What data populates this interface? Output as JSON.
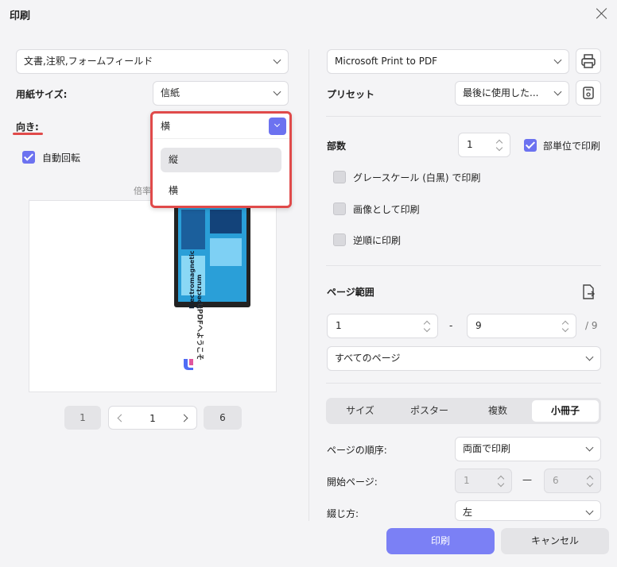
{
  "dialog": {
    "title": "印刷"
  },
  "left": {
    "content_select": "文書,注釈,フォームフィールド",
    "paper_size_label": "用紙サイズ:",
    "paper_size_value": "信紙",
    "orientation_label": "向き:",
    "orientation_value": "横",
    "auto_rotate_label": "自動回転",
    "scale_label_partial": "倍率",
    "orientation_options": [
      "縦",
      "横"
    ],
    "pager": {
      "first": "1",
      "current": "1",
      "last": "6"
    },
    "preview_text": {
      "banner1": "Electromagnetic",
      "banner2": "Spectrum",
      "welcome": "UPDFへようこそ"
    }
  },
  "right": {
    "printer": "Microsoft Print to PDF",
    "preset_label": "プリセット",
    "preset_value": "最後に使用した...",
    "copies_label": "部数",
    "copies_value": "1",
    "collate_label": "部単位で印刷",
    "grayscale_label": "グレースケール (白黒) で印刷",
    "as_image_label": "画像として印刷",
    "reverse_label": "逆順に印刷",
    "page_range_label": "ページ範囲",
    "range_from": "1",
    "range_sep": "-",
    "range_to": "9",
    "range_total": "/ 9",
    "range_subset": "すべてのページ",
    "tabs": [
      "サイズ",
      "ポスター",
      "複数",
      "小冊子"
    ],
    "page_order_label": "ページの順序:",
    "page_order_value": "両面で印刷",
    "start_page_label": "開始ページ:",
    "start_from": "1",
    "start_sep": "—",
    "start_to": "6",
    "binding_label": "綴じ方:",
    "binding_value": "左"
  },
  "buttons": {
    "print": "印刷",
    "cancel": "キャンセル"
  },
  "colors": {
    "accent": "#6c72f0",
    "highlight": "#e04a4a"
  }
}
